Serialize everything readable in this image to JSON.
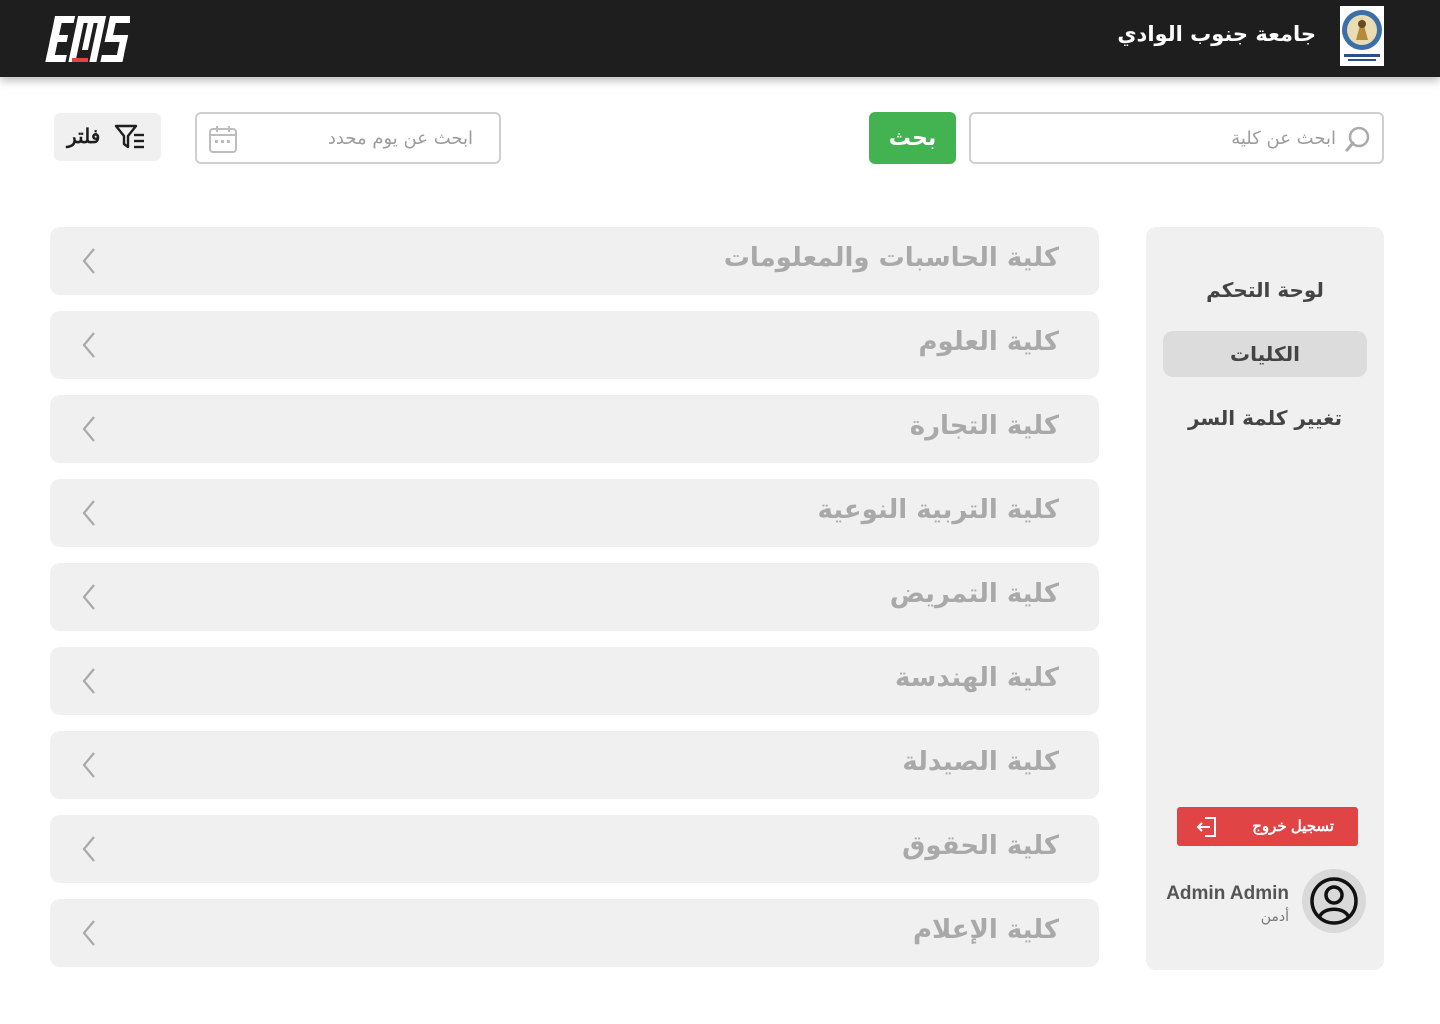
{
  "header": {
    "logo_text": "EMS",
    "university_name": "جامعة جنوب الوادي",
    "crest_icon": "university-crest-icon"
  },
  "search": {
    "college_placeholder": "ابحث عن كلية",
    "search_button": "بحث",
    "date_placeholder": "ابحث عن يوم محدد",
    "filter_button": "فلتر"
  },
  "colleges": [
    {
      "name": "كلية الحاسبات والمعلومات"
    },
    {
      "name": "كلية العلوم"
    },
    {
      "name": "كلية التجارة"
    },
    {
      "name": "كلية التربية النوعية"
    },
    {
      "name": "كلية التمريض"
    },
    {
      "name": "كلية الهندسة"
    },
    {
      "name": "كلية الصيدلة"
    },
    {
      "name": "كلية الحقوق"
    },
    {
      "name": "كلية الإعلام"
    }
  ],
  "sidebar": {
    "items": [
      {
        "label": "لوحة التحكم",
        "active": false
      },
      {
        "label": "الكليات",
        "active": true
      },
      {
        "label": "تغيير كلمة السر",
        "active": false
      }
    ],
    "logout": "تسجيل خروج",
    "user": {
      "name": "Admin Admin",
      "role": "أدمن"
    }
  },
  "colors": {
    "header_bg": "#1e1e1e",
    "search_button": "#43b352",
    "logout_button": "#e04444",
    "item_bg": "#f0f0f0",
    "active_item_bg": "#dcdcdc"
  }
}
